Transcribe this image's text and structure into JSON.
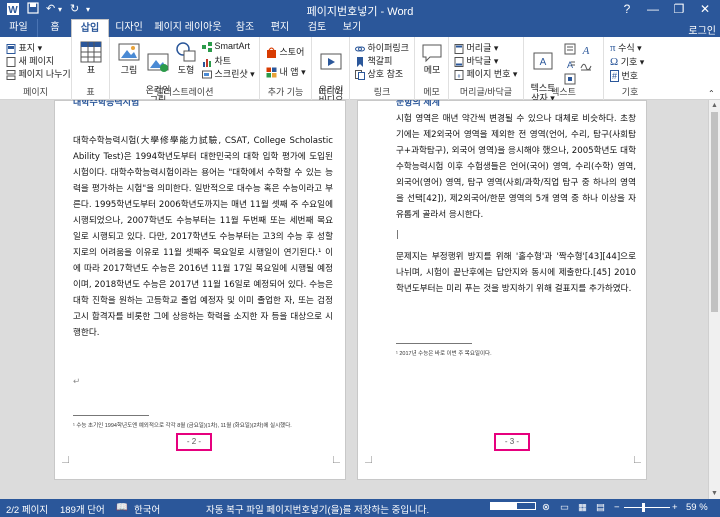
{
  "window": {
    "title": "페이지번호넣기 - Word",
    "minimize": "—",
    "restore": "❐",
    "close": "✕",
    "help": "?"
  },
  "tabs": [
    "파일",
    "홈",
    "삽입",
    "디자인",
    "페이지 레이아웃",
    "참조",
    "편지",
    "검토",
    "보기"
  ],
  "active_tab": "삽입",
  "signin": "로그인",
  "ribbon": {
    "pages": {
      "items": [
        "표지 ▾",
        "새 페이지",
        "페이지 나누기"
      ],
      "label": "페이지"
    },
    "table": {
      "button": "표",
      "label": "표"
    },
    "illustrations": {
      "picture": "그림",
      "online_picture": "온라인\n그림",
      "shapes": "도형",
      "smartart": "SmartArt",
      "chart": "차트",
      "screenshot": "스크린샷 ▾",
      "label": "일러스트레이션"
    },
    "addins": {
      "store": "스토어",
      "my_addins": "내 앱 ▾",
      "label": "추가 기능"
    },
    "media": {
      "online_video": "온라인\n비디오",
      "label": "미디어"
    },
    "links": {
      "hyperlink": "하이퍼링크",
      "bookmark": "책갈피",
      "cross_reference": "상호 참조",
      "label": "링크"
    },
    "comments": {
      "comment": "메모",
      "label": "메모"
    },
    "header_footer": {
      "header": "머리글 ▾",
      "footer": "바닥글 ▾",
      "page_number": "페이지 번호 ▾",
      "label": "머리글/바닥글"
    },
    "text": {
      "textbox": "텍스트\n상자 ▾",
      "label": "텍스트"
    },
    "symbols": {
      "equation": "수식 ▾",
      "symbol": "기호 ▾",
      "number": "번호",
      "label": "기호"
    }
  },
  "page1": {
    "heading_cut": "대학수학능력시험",
    "paragraph": "대학수학능력시험(大學修學能力試驗, CSAT, College Scholastic Ability Test)은 1994학년도부터 대한민국의 대학 입학 평가에 도입된 시험이다. 대학수학능력시험이라는 용어는 \"대학에서 수학할 수 있는 능력을 평가하는 시험\"을 의미한다. 일반적으로 대수능 혹은 수능이라고 부른다. 1995학년도부터 2006학년도까지는 매년 11월 셋째 주 수요일에 시행되었으나, 2007학년도 수능부터는 11월 두번째 또는 세번째 목요일로 시행되고 있다. 다만, 2017학년도 수능부터는 고3의 수능 후 성할 지로의 어려움을 이유로 11월 셋째주 목요일로 시행일이 연기된다.¹ 이에 따라 2017학년도 수능은 2016년 11월 17일 목요일에 시행될 예정이며, 2018학년도 수능은 2017년 11월 16일로 예정되어 있다. 수능은 대학 진학을 원하는 고등학교 졸업 예정자 및 이미 졸업한 자, 또는 검정고시 합격자를 비롯한 그에 상응하는 학력을 소지한 자 등을 대상으로 시행한다.",
    "footnote": "¹ 수능 초기인 1994학년도엔 예외적으로 각각 8월 (금요일)(1차), 11월 (화요일)(2차)에 실시했다.",
    "page_number": "- 2 -"
  },
  "page2": {
    "heading_cut": "문항의 체계",
    "paragraph1": "시험 영역은 매년 약간씩 변경될 수 있으나 대체로 비슷하다. 초창기에는 제2외국어 영역을 제외한 전 영역(언어, 수리, 탐구(사회탐구+과학탐구), 외국어 영역)을 응시해야 했으나, 2005학년도 대학수학능력시험 이후 수험생들은 언어(국어) 영역, 수리(수학) 영역, 외국어(영어) 영역, 탐구 영역(사회/과학/직업 탐구 중 하나의 영역을 선택[42]), 제2외국어/한문 영역의 5개 영역 중 하나 이상을 자유롭게 골라서 응시한다.",
    "paragraph2": "문제지는 부정행위 방지를 위해 '홀수형'과 '짝수형'[43][44]으로 나뉘며, 시험이 끝난후에는 답안지와 동시에 제출한다.[45] 2010학년도부터는 미리 푸는 것을 방지하기 위해 걸표지를 추가하였다.",
    "footnote": "¹ 2017년 수능은 바로 이번 주 목요일이다.",
    "page_number": "- 3 -"
  },
  "status": {
    "page": "2/2 페이지",
    "words": "189개 단어",
    "language": "한국어",
    "autosave": "자동 복구 파일 페이지번호넣기(을)를 저장하는 중입니다.",
    "zoom": "59 %"
  }
}
